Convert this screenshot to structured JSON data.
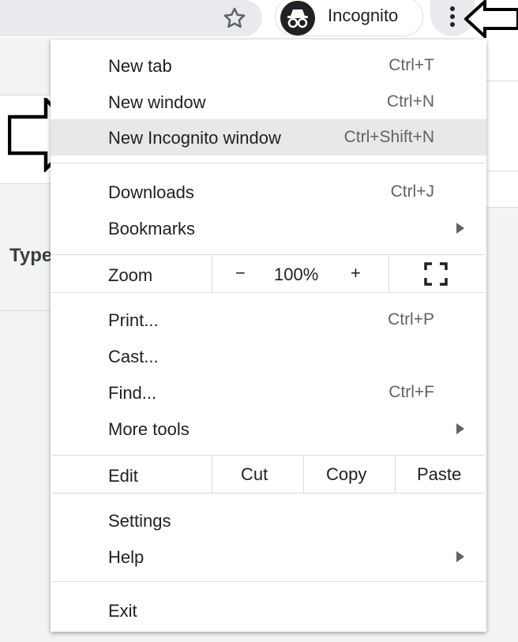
{
  "toolbar": {
    "profile_label": "Incognito",
    "icons": {
      "star": "star-outline-icon",
      "incognito": "incognito-icon",
      "menu": "more-vert-icon"
    }
  },
  "background": {
    "partial_text": "Type"
  },
  "menu": {
    "section1": [
      {
        "label": "New tab",
        "shortcut": "Ctrl+T"
      },
      {
        "label": "New window",
        "shortcut": "Ctrl+N"
      },
      {
        "label": "New Incognito window",
        "shortcut": "Ctrl+Shift+N",
        "highlighted": true
      }
    ],
    "section2": [
      {
        "label": "Downloads",
        "shortcut": "Ctrl+J"
      },
      {
        "label": "Bookmarks",
        "submenu": true
      }
    ],
    "zoom": {
      "label": "Zoom",
      "minus": "−",
      "value": "100%",
      "plus": "+",
      "fullscreen_icon": "fullscreen-icon"
    },
    "section3": [
      {
        "label": "Print...",
        "shortcut": "Ctrl+P"
      },
      {
        "label": "Cast..."
      },
      {
        "label": "Find...",
        "shortcut": "Ctrl+F"
      },
      {
        "label": "More tools",
        "submenu": true
      }
    ],
    "edit": {
      "label": "Edit",
      "cut": "Cut",
      "copy": "Copy",
      "paste": "Paste"
    },
    "section4": [
      {
        "label": "Settings"
      },
      {
        "label": "Help",
        "submenu": true
      }
    ],
    "exit": {
      "label": "Exit"
    }
  },
  "colors": {
    "highlight": "#e8e8e8",
    "menu_bg": "#ffffff",
    "separator": "#dadce0",
    "text": "#202124"
  }
}
